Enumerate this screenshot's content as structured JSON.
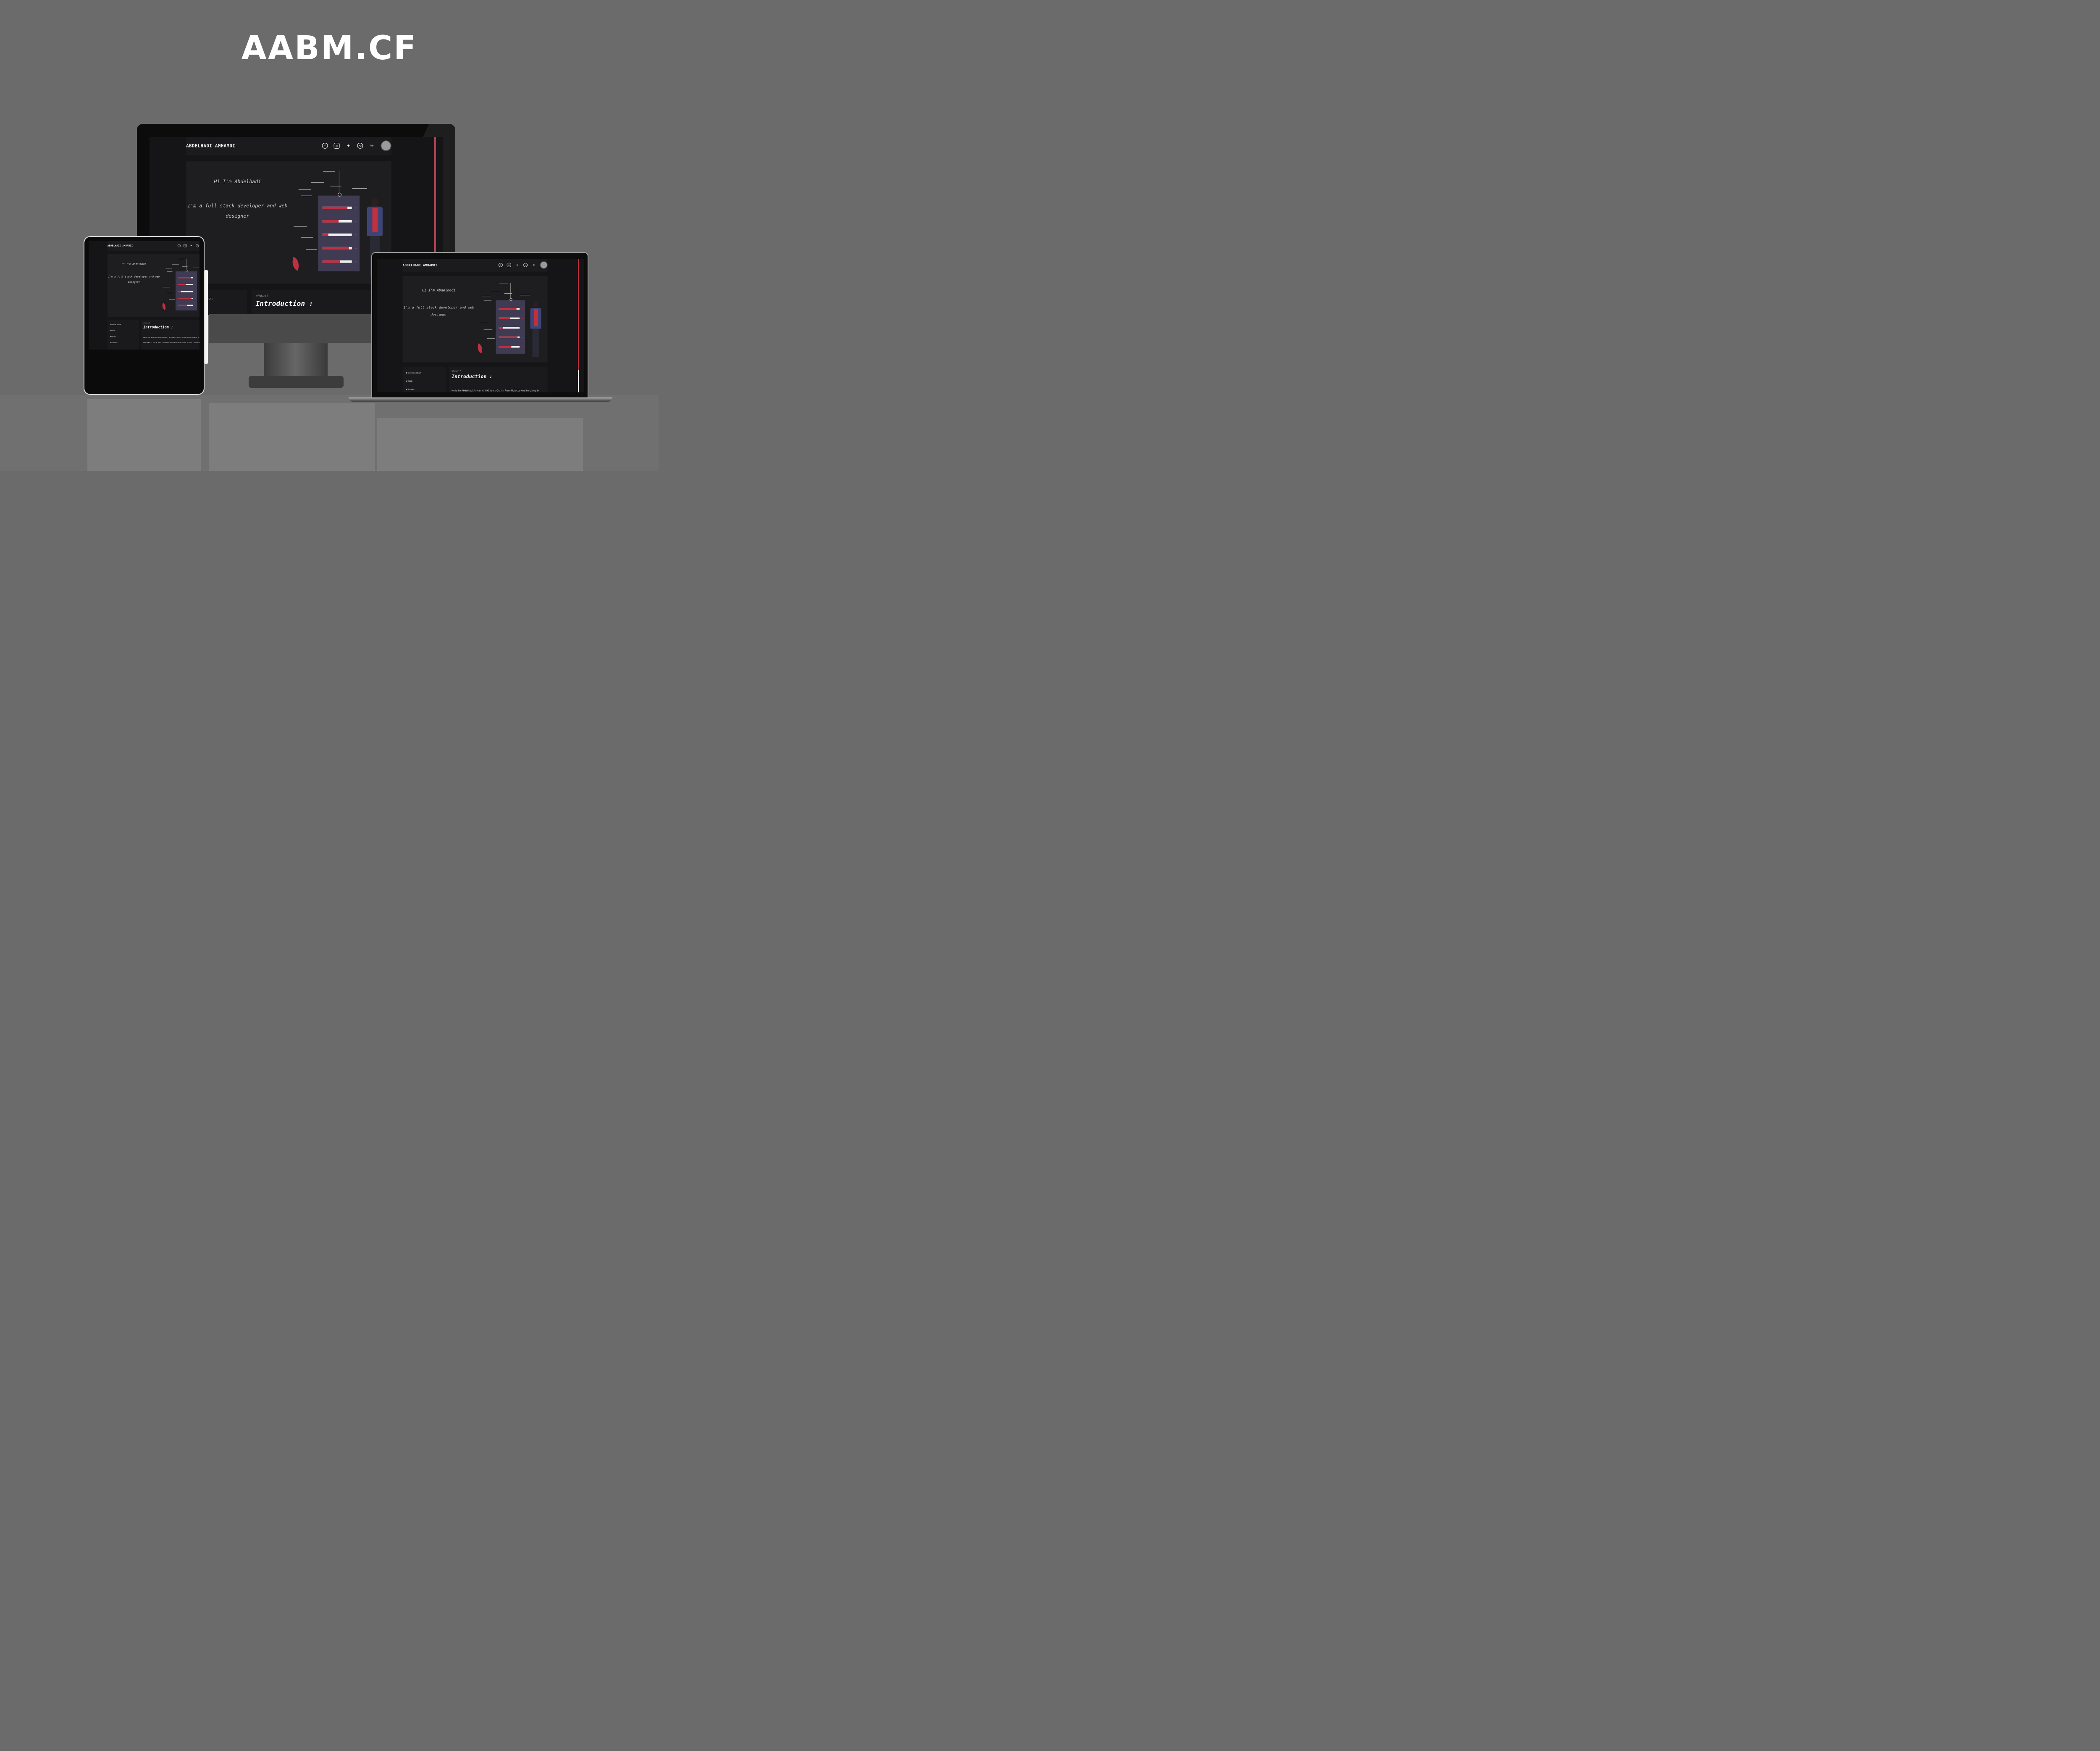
{
  "title": "AABM.CF",
  "site": {
    "brand": "ABDELHADI AMHAMDI",
    "social_icons": [
      "facebook-icon",
      "instagram-icon",
      "twitter-icon",
      "github-icon",
      "sun-icon"
    ],
    "hero": {
      "greeting": "Hi I'm Abdelhadi",
      "tagline": "I'm a full stack developer and web designer"
    },
    "sidebar": [
      "#Introduction",
      "#Skills",
      "#Works",
      "#Contact"
    ],
    "content": {
      "breadcrumb": "whoiam ?",
      "heading": "Introduction :",
      "text": "Hello Im Abdelhadi Amhamdi I 90 Years Old Im From Morocco And Im Living In Marrakech , Im A Web Designer And Web Developer , I Love Design And Creating"
    },
    "accent": "#c0303f",
    "scroll_progress": 0.75
  },
  "skill_levels": [
    0.85,
    0.55,
    0.2,
    0.9,
    0.6
  ]
}
